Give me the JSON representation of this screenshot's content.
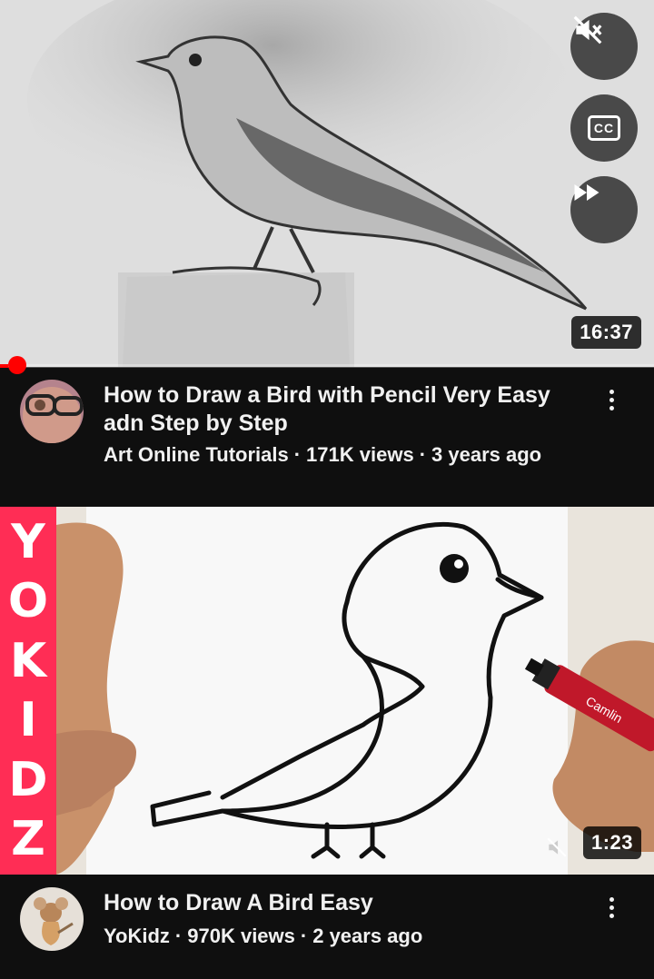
{
  "videos": [
    {
      "title": "How to Draw a Bird with Pencil Very Easy adn Step by Step",
      "channel": "Art Online Tutorials",
      "views": "171K views",
      "age": "3 years ago",
      "duration": "16:37",
      "progress_fraction": 0.012,
      "controls": [
        "mute-icon",
        "captions-icon",
        "fast-forward-icon"
      ],
      "captions_label": "CC"
    },
    {
      "title": "How to Draw A Bird Easy",
      "channel": "YoKidz",
      "views": "970K views",
      "age": "2 years ago",
      "duration": "1:23",
      "brand_letters": [
        "Y",
        "O",
        "K",
        "I",
        "D",
        "Z"
      ],
      "marker_text": "Camlin"
    }
  ],
  "separator": "·",
  "colors": {
    "background": "#0f0f0f",
    "accent": "#ff0000",
    "brand": "#ff2d55"
  }
}
